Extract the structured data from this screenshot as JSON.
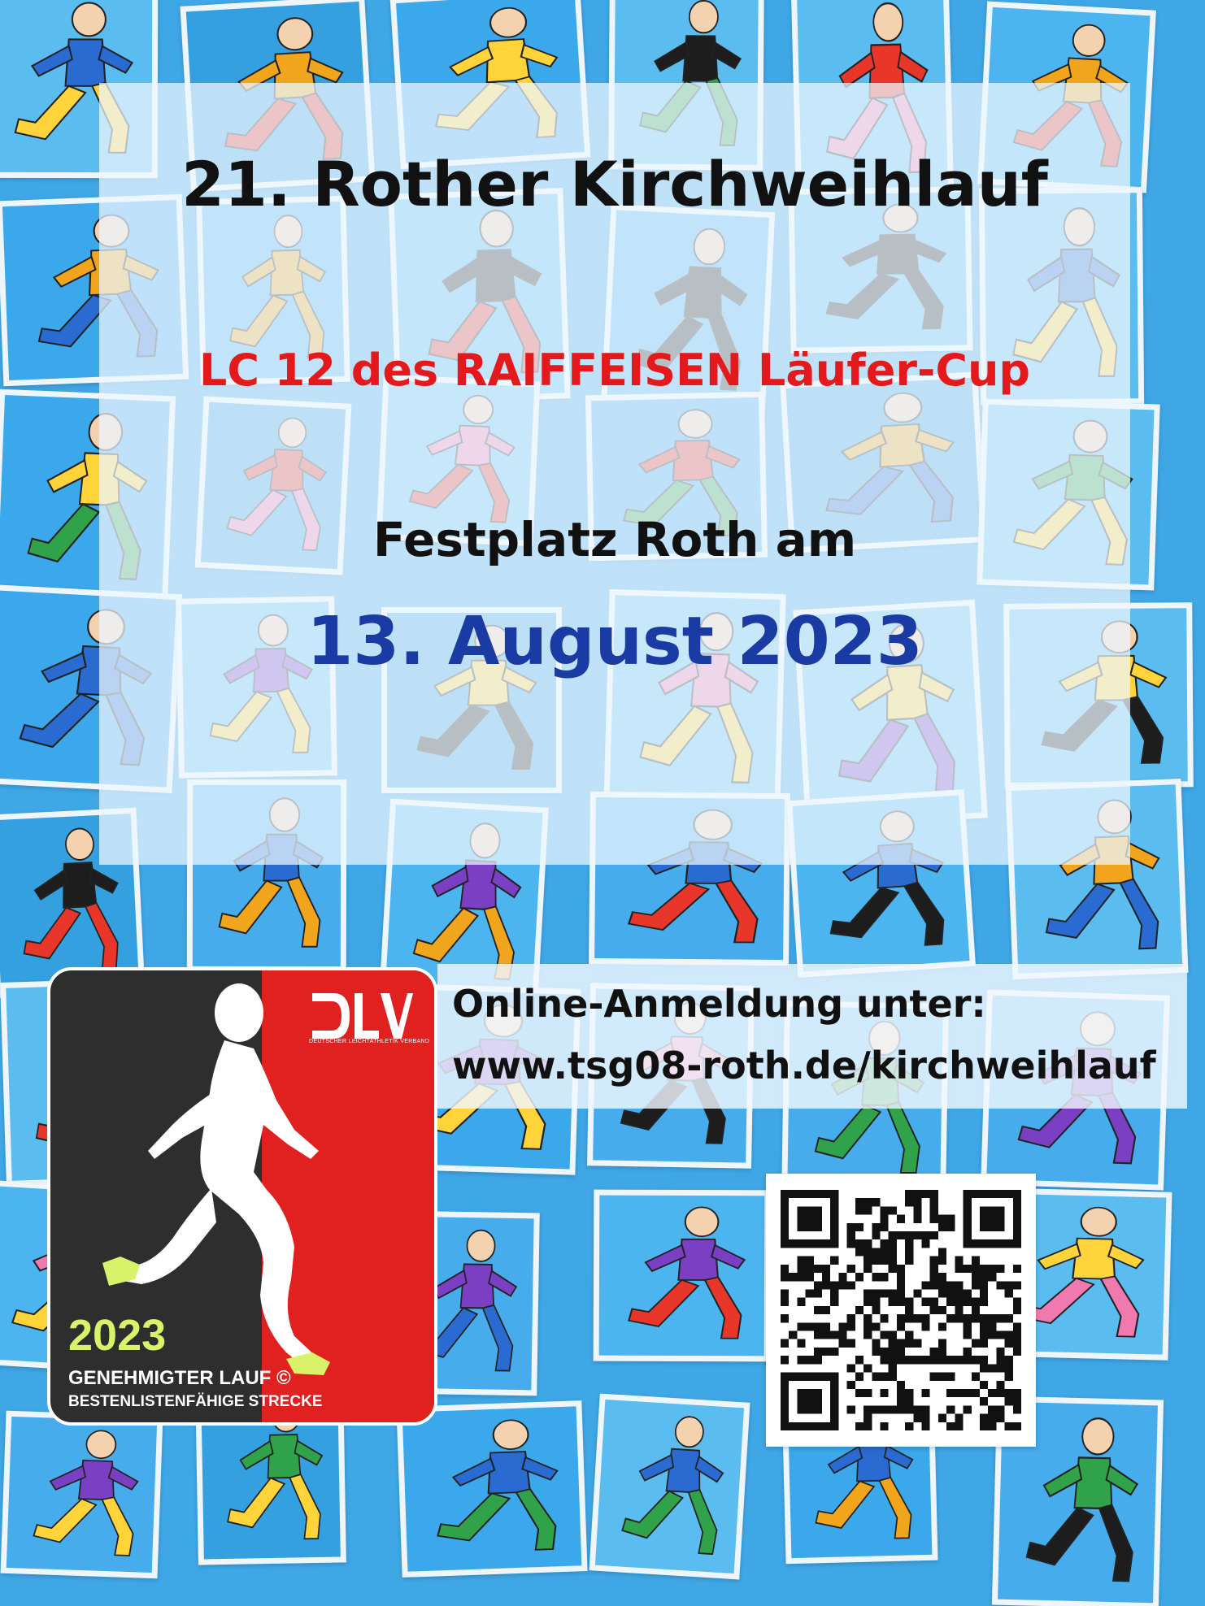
{
  "poster": {
    "title": "21. Rother Kirchweihlauf",
    "subtitle": "LC 12 des RAIFFEISEN Läufer-Cup",
    "venue": "Festplatz Roth am",
    "date": "13. August 2023"
  },
  "registration": {
    "label": "Online-Anmeldung unter:",
    "url": "www.tsg08-roth.de/kirchweihlauf"
  },
  "badge": {
    "logo_text": "DLV",
    "logo_subtext": "DEUTSCHER LEICHTATHLETIK VERBAND",
    "year": "2023",
    "line1": "GENEHMIGTER LAUF ©",
    "line2": "BESTENLISTENFÄHIGE STRECKE"
  },
  "qr_code": {
    "icon": "qr-code-icon"
  },
  "colors": {
    "title": "#111111",
    "subtitle_red": "#e3191b",
    "date_blue": "#1a3aa4",
    "badge_red": "#e1211f",
    "badge_dark": "#2e2e2e",
    "badge_year": "#d8f26a",
    "background_blue": "#3fa7e6"
  }
}
